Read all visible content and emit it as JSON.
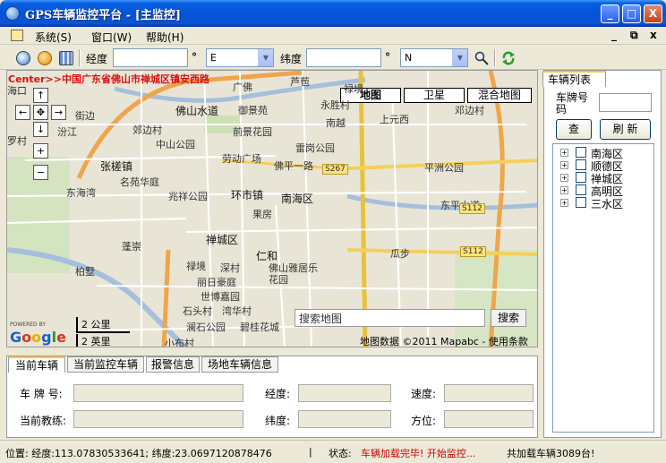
{
  "window": {
    "title": "GPS车辆监控平台 - [主监控]",
    "buttons": [
      "_",
      "□",
      "X"
    ]
  },
  "menu": {
    "items": [
      "系统(S)",
      "窗口(W)",
      "帮助(H)"
    ],
    "mdi_buttons": [
      "_",
      "⧉",
      "x"
    ]
  },
  "toolbar": {
    "lng_label": "经度",
    "lng_value": "",
    "lng_deg": "°",
    "lng_dir": "E",
    "lat_label": "纬度",
    "lat_value": "",
    "lat_deg": "°",
    "lat_dir": "N"
  },
  "map": {
    "center_text": "Center>>中国广东省佛山市禅城区镇安西路",
    "types": [
      "地图",
      "卫星",
      "混合地图"
    ],
    "active_type": "地图",
    "nav": {
      "up": "↑",
      "left": "←",
      "center": "✥",
      "right": "→",
      "down": "↓",
      "zoom_in": "+",
      "zoom_out": "−"
    },
    "labels": [
      "佛山水道",
      "御景苑",
      "永胜村",
      "南越",
      "上元西",
      "邓边村",
      "前景花园",
      "中山公园",
      "雷岗公园",
      "张槎镇",
      "名苑华庭",
      "劳动广场",
      "佛平一路",
      "平洲公园",
      "东海湾",
      "兆祥公园",
      "环市镇",
      "南海区",
      "东平水道",
      "禅城区",
      "果房",
      "仁和",
      "佛山雅居乐花园",
      "瓜步",
      "柏墅",
      "深村",
      "丽日豪庭",
      "世博嘉园",
      "石头村",
      "湾华村",
      "澜石公园",
      "碧桂花城",
      "小布村",
      "汾江",
      "街边",
      "郊边村",
      "罗村",
      "芦苞",
      "海口",
      "广佛",
      "禄境",
      "蓬崇"
    ],
    "shields": [
      "S267",
      "S112",
      "S112"
    ],
    "search_placeholder": "搜索地图",
    "search_button": "搜索",
    "scale_km": "2 公里",
    "scale_mi": "2 英里",
    "powered": "POWERED BY",
    "logo": "Google",
    "copyright": "地图数据 ©2011 Mapabc - 使用条款"
  },
  "vehicle_panel": {
    "tab": "车辆列表",
    "plate_label": "车牌号码",
    "plate_value": "",
    "query_button": "查",
    "refresh_button": "刷 新",
    "tree": [
      "南海区",
      "顺德区",
      "禅城区",
      "高明区",
      "三水区"
    ]
  },
  "bottom": {
    "tabs": [
      "当前车辆",
      "当前监控车辆",
      "报警信息",
      "场地车辆信息"
    ],
    "active_tab": "当前车辆",
    "fields": {
      "plate_label": "车 牌 号:",
      "plate_value": "",
      "coach_label": "当前教练:",
      "coach_value": "",
      "lng_label": "经度:",
      "lng_value": "",
      "lat_label": "纬度:",
      "lat_value": "",
      "speed_label": "速度:",
      "speed_value": "",
      "heading_label": "方位:",
      "heading_value": ""
    }
  },
  "status": {
    "position": "位置: 经度:113.07830533641; 纬度:23.0697120878476",
    "divider": "|",
    "state_label": "状态:",
    "state_value": "车辆加载完毕! 开始监控...",
    "total": "共加载车辆3089台!"
  },
  "colors": {
    "titlebar": "#0553d8",
    "status_red": "#cc0000",
    "link_blue": "#1a1aa6"
  }
}
